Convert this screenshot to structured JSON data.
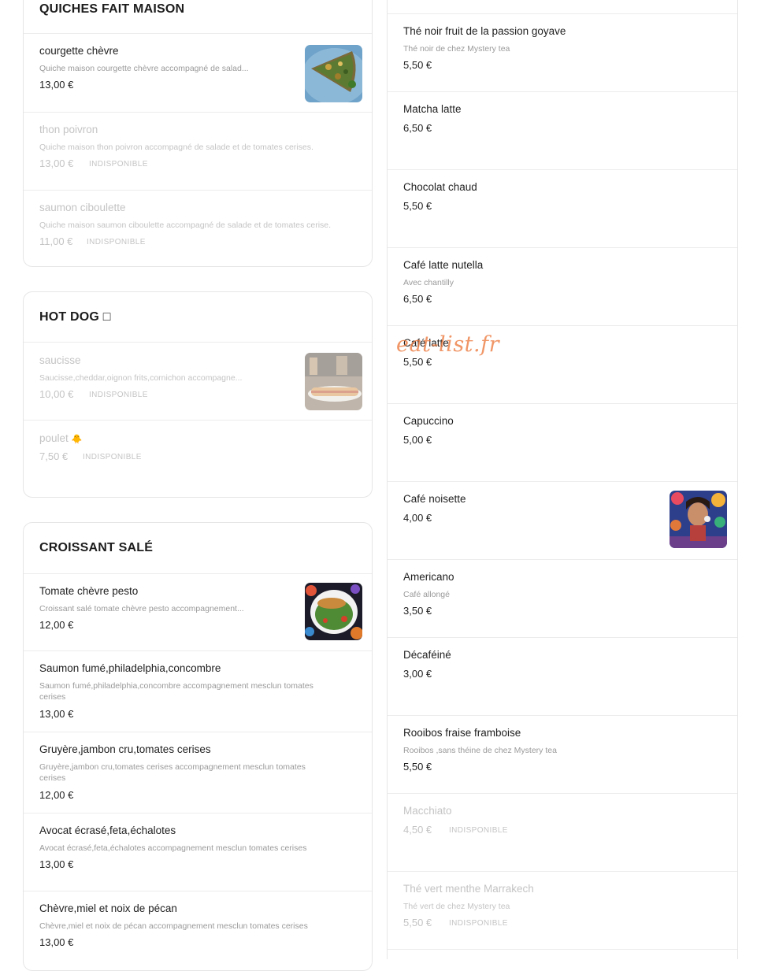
{
  "quiches": {
    "title": "QUICHES FAIT MAISON",
    "items": [
      {
        "name": "courgette chèvre",
        "desc": "Quiche maison courgette chèvre accompagné de salad...",
        "price": "13,00 €",
        "unavailable": ""
      },
      {
        "name": "thon poivron",
        "desc": "Quiche maison thon poivron accompagné de salade et de tomates cerises.",
        "price": "13,00 €",
        "unavailable": "INDISPONIBLE"
      },
      {
        "name": "saumon ciboulette",
        "desc": "Quiche maison saumon ciboulette accompagné de salade et de tomates cerise.",
        "price": "11,00 €",
        "unavailable": "INDISPONIBLE"
      }
    ]
  },
  "hotdog": {
    "title": "HOT DOG ",
    "title_glyph": "□",
    "items": [
      {
        "name": "saucisse",
        "desc": "Saucisse,cheddar,oignon frits,cornichon accompagne...",
        "price": "10,00 €",
        "unavailable": "INDISPONIBLE"
      },
      {
        "name": "poulet ",
        "emoji": "🐥",
        "price": "7,50 €",
        "unavailable": "INDISPONIBLE"
      }
    ]
  },
  "croissant": {
    "title": "CROISSANT SALÉ",
    "items": [
      {
        "name": "Tomate chèvre pesto",
        "desc": "Croissant salé tomate chèvre pesto accompagnement...",
        "price": "12,00 €"
      },
      {
        "name": "Saumon fumé,philadelphia,concombre",
        "desc": "Saumon fumé,philadelphia,concombre accompagnement mesclun tomates cerises",
        "price": "13,00 €"
      },
      {
        "name": "Gruyère,jambon cru,tomates cerises",
        "desc": "Gruyère,jambon cru,tomates cerises accompagnement mesclun tomates cerises",
        "price": "12,00 €"
      },
      {
        "name": "Avocat écrasé,feta,échalotes",
        "desc": "Avocat écrasé,feta,échalotes accompagnement mesclun tomates cerises",
        "price": "13,00 €"
      },
      {
        "name": "Chèvre,miel et noix de pécan",
        "desc": "Chèvre,miel et noix de pécan accompagnement mesclun tomates cerises",
        "price": "13,00 €"
      }
    ]
  },
  "drinks": {
    "items": [
      {
        "name": "Thé noir fruit de la passion goyave",
        "desc": "Thé noir de chez Mystery tea",
        "price": "5,50 €",
        "unavailable": ""
      },
      {
        "name": "Matcha latte",
        "desc": "",
        "price": "6,50 €",
        "unavailable": ""
      },
      {
        "name": "Chocolat chaud",
        "desc": "",
        "price": "5,50 €",
        "unavailable": ""
      },
      {
        "name": "Café latte nutella",
        "desc": "Avec chantilly",
        "price": "6,50 €",
        "unavailable": ""
      },
      {
        "name": "Café latte",
        "desc": "",
        "price": "5,50 €",
        "unavailable": ""
      },
      {
        "name": "Capuccino",
        "desc": "",
        "price": "5,00 €",
        "unavailable": ""
      },
      {
        "name": "Café noisette",
        "desc": "",
        "price": "4,00 €",
        "unavailable": ""
      },
      {
        "name": "Americano",
        "desc": "Café allongé",
        "price": "3,50 €",
        "unavailable": ""
      },
      {
        "name": "Décaféiné",
        "desc": "",
        "price": "3,00 €",
        "unavailable": ""
      },
      {
        "name": "Rooibos fraise framboise",
        "desc": "Rooibos ,sans théine de chez Mystery tea",
        "price": "5,50 €",
        "unavailable": ""
      },
      {
        "name": "Macchiato",
        "desc": "",
        "price": "4,50 €",
        "unavailable": "INDISPONIBLE"
      },
      {
        "name": "Thé vert menthe Marrakech",
        "desc": "Thé vert de chez Mystery tea",
        "price": "5,50 €",
        "unavailable": "INDISPONIBLE"
      }
    ]
  },
  "watermark": "eat-list.fr",
  "icons": {
    "quiche_photo": "quiche-image",
    "hotdog_photo": "hotdog-image",
    "croissant_photo": "croissant-salad-image",
    "cafe_photo": "painting-image"
  },
  "colors": {
    "text": "#1f1f1f",
    "muted": "#9a9a9a",
    "disabled": "#c4c4c4",
    "border": "#e6e6e6",
    "watermark": "#ec783c"
  }
}
